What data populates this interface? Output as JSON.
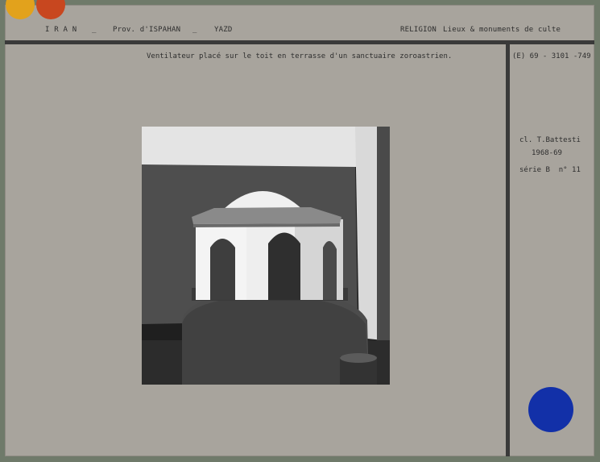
{
  "header": {
    "country": "I R A N",
    "sep1": "_",
    "province": "Prov. d'ISPAHAN",
    "sep2": "_",
    "city": "YAZD",
    "category": "RELIGION",
    "subcategory": "Lieux & monuments de culte"
  },
  "caption": "Ventilateur placé sur le toit en terrasse d'un sanctuaire zoroastrien.",
  "reference": "(E) 69 - 3101 -749",
  "credit": {
    "photographer": "cl. T.Battesti",
    "year": "1968-69",
    "series": "série B  n° 11"
  },
  "colors": {
    "dot_yellow": "#e2a21c",
    "dot_orange": "#c8471f",
    "dot_blue": "#1230a8"
  }
}
